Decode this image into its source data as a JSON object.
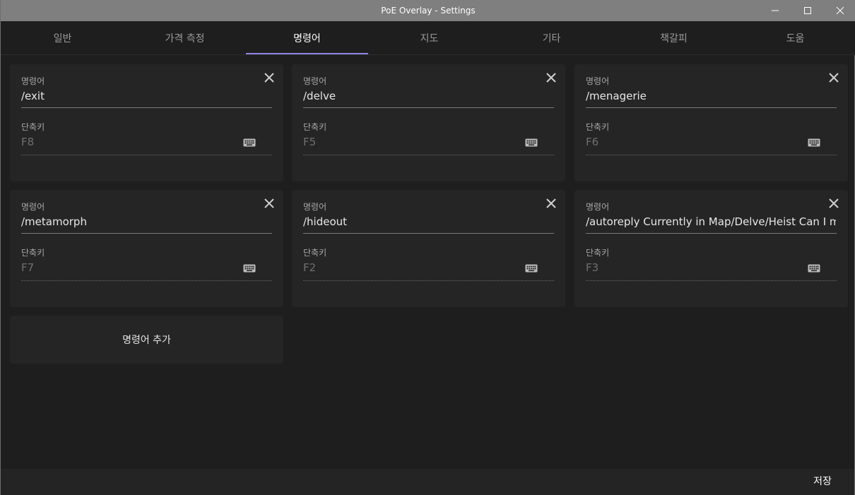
{
  "window": {
    "title": "PoE Overlay - Settings"
  },
  "tabs": [
    {
      "label": "일반"
    },
    {
      "label": "가격 측정"
    },
    {
      "label": "명령어"
    },
    {
      "label": "지도"
    },
    {
      "label": "기타"
    },
    {
      "label": "책갈피"
    },
    {
      "label": "도움"
    }
  ],
  "active_tab": "명령어",
  "accent_color": "#8f86e6",
  "labels": {
    "command": "명령어",
    "shortcut": "단축키"
  },
  "commands": [
    {
      "command": "/exit",
      "shortcut": "F8"
    },
    {
      "command": "/delve",
      "shortcut": "F5"
    },
    {
      "command": "/menagerie",
      "shortcut": "F6"
    },
    {
      "command": "/metamorph",
      "shortcut": "F7"
    },
    {
      "command": "/hideout",
      "shortcut": "F2"
    },
    {
      "command": "/autoreply Currently in Map/Delve/Heist Can I mes",
      "shortcut": "F3"
    }
  ],
  "icons": {
    "remove": "close-icon",
    "shortcut": "keyboard-icon",
    "minimize": "minimize-icon",
    "maximize": "maximize-icon",
    "close": "close-icon"
  },
  "add_button_label": "명령어 추가",
  "save_button_label": "저장"
}
